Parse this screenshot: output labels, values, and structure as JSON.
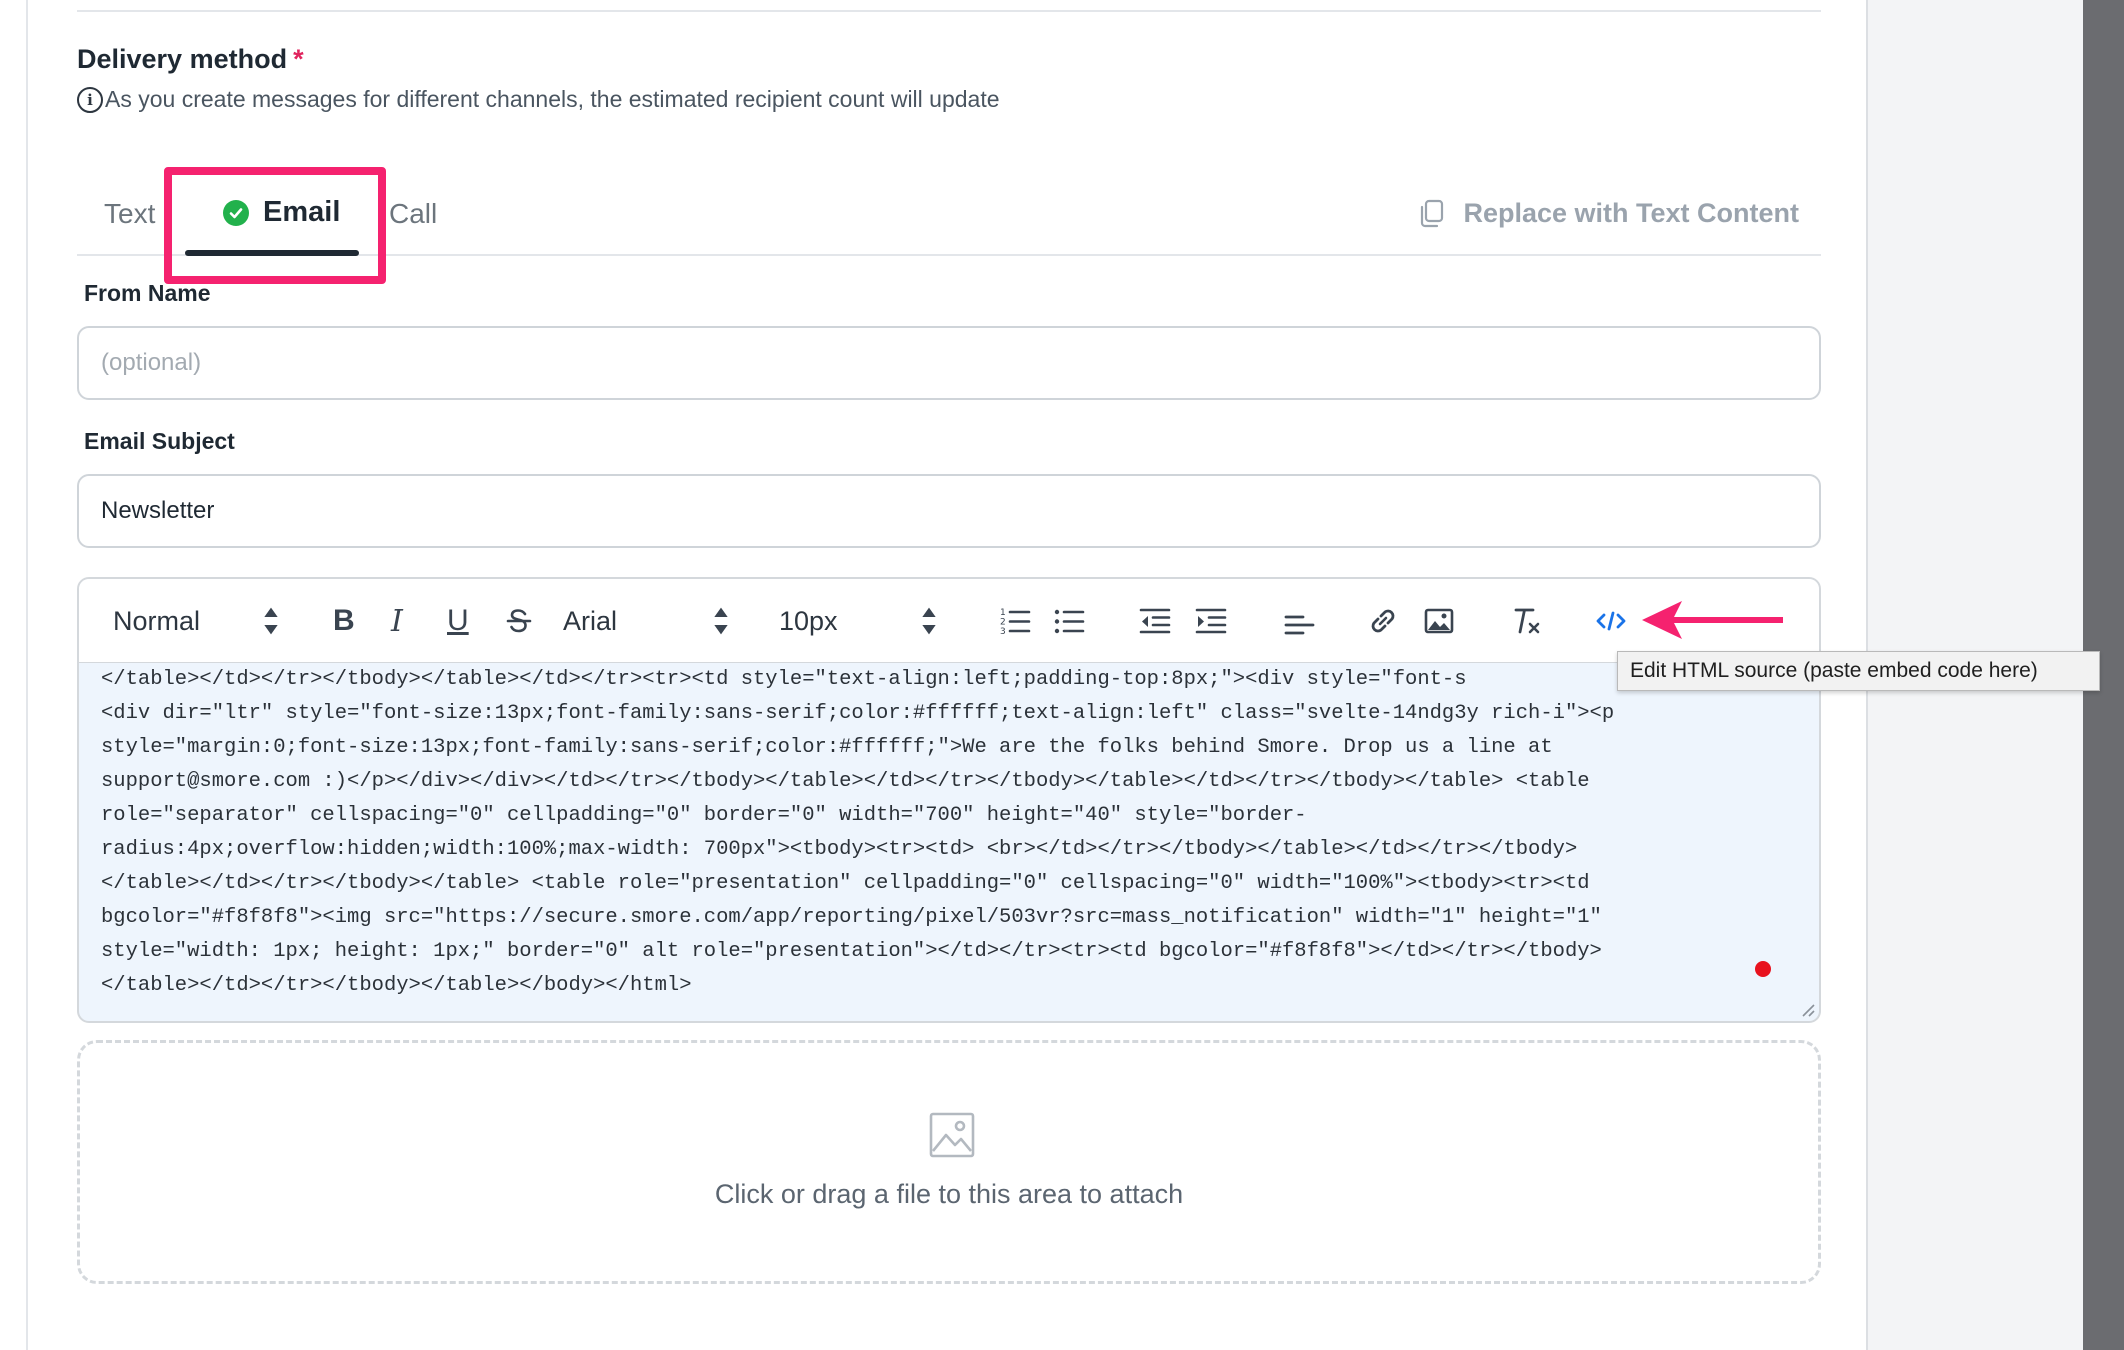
{
  "delivery": {
    "title": "Delivery method",
    "required_mark": "*",
    "info_text": "As you create messages for different channels, the estimated recipient count will update",
    "info_icon": "i"
  },
  "tabs": [
    {
      "label": "Text",
      "active": false
    },
    {
      "label": "Email",
      "active": true,
      "status_icon": "check-circle-icon"
    },
    {
      "label": "Call",
      "active": false
    }
  ],
  "replace_button": {
    "label": "Replace with Text Content",
    "icon": "copy-icon"
  },
  "from_name": {
    "label": "From Name",
    "placeholder": "(optional)",
    "value": ""
  },
  "email_subject": {
    "label": "Email Subject",
    "value": "Newsletter"
  },
  "toolbar": {
    "paragraph_style": "Normal",
    "bold": "B",
    "italic": "I",
    "underline": "U",
    "font_family": "Arial",
    "font_size": "10px",
    "source_button_tooltip": "Edit HTML source (paste embed code here)"
  },
  "html_source_lines": [
    "</table></td></tr></tbody></table></td></tr><tr><td style=\"text-align:left;padding-top:8px;\"><div style=\"font-s",
    "<div dir=\"ltr\" style=\"font-size:13px;font-family:sans-serif;color:#ffffff;text-align:left\" class=\"svelte-14ndg3y rich-i\"><p",
    "style=\"margin:0;font-size:13px;font-family:sans-serif;color:#ffffff;\">We are the folks behind Smore. Drop us a line at",
    "support@smore.com :)</p></div></div></td></tr></tbody></table></td></tr></tbody></table></td></tr></tbody></table> <table",
    "role=\"separator\" cellspacing=\"0\" cellpadding=\"0\" border=\"0\" width=\"700\" height=\"40\" style=\"border-",
    "radius:4px;overflow:hidden;width:100%;max-width: 700px\"><tbody><tr><td> <br></td></tr></tbody></table></td></tr></tbody>",
    "</table></td></tr></tbody></table> <table role=\"presentation\" cellpadding=\"0\" cellspacing=\"0\" width=\"100%\"><tbody><tr><td",
    "bgcolor=\"#f8f8f8\"><img src=\"https://secure.smore.com/app/reporting/pixel/503vr?src=mass_notification\" width=\"1\" height=\"1\"",
    "style=\"width: 1px; height: 1px;\" border=\"0\" alt role=\"presentation\"></td></tr><tr><td bgcolor=\"#f8f8f8\"></td></tr></tbody>",
    "</table></td></tr></tbody></table></body></html>"
  ],
  "attachment": {
    "label": "Click or drag a file to this area to attach",
    "icon": "image-icon"
  },
  "colors": {
    "highlight": "#f5226f",
    "required": "#e0245e",
    "check": "#22b14c",
    "source_icon": "#1a73e8"
  }
}
